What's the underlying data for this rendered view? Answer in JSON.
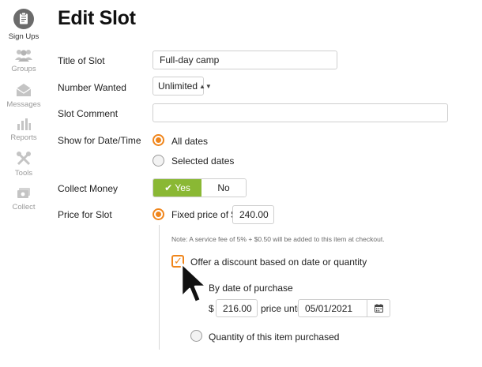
{
  "sidebar": {
    "items": [
      {
        "label": "Sign Ups",
        "icon": "clipboard-icon",
        "active": true
      },
      {
        "label": "Groups",
        "icon": "people-icon",
        "active": false
      },
      {
        "label": "Messages",
        "icon": "envelope-icon",
        "active": false
      },
      {
        "label": "Reports",
        "icon": "bar-chart-icon",
        "active": false
      },
      {
        "label": "Tools",
        "icon": "tools-icon",
        "active": false
      },
      {
        "label": "Collect",
        "icon": "cash-icon",
        "active": false
      }
    ]
  },
  "page": {
    "title": "Edit Slot"
  },
  "form": {
    "title_label": "Title of Slot",
    "title_value": "Full-day camp",
    "wanted_label": "Number Wanted",
    "wanted_value": "Unlimited",
    "comment_label": "Slot Comment",
    "comment_value": "",
    "show_label": "Show for Date/Time",
    "show_options": [
      "All dates",
      "Selected dates"
    ],
    "show_selected": "All dates",
    "collect_label": "Collect Money",
    "collect_yes": "Yes",
    "collect_no": "No",
    "price_label": "Price for Slot",
    "fixed_price_label": "Fixed price of $",
    "fixed_price_value": "240.00",
    "fee_note": "Note: A service fee of 5% + $0.50 will be added to this item at checkout.",
    "discount_label": "Offer a discount based on date or quantity",
    "discount_checked": true,
    "by_date_label": "By date of purchase",
    "currency_symbol": "$",
    "discount_price_value": "216.00",
    "price_until_label": "price until",
    "until_date_value": "05/01/2021",
    "quantity_label": "Quantity of this item purchased"
  },
  "colors": {
    "accent": "#f0861c",
    "toggle_on": "#8ab834"
  }
}
